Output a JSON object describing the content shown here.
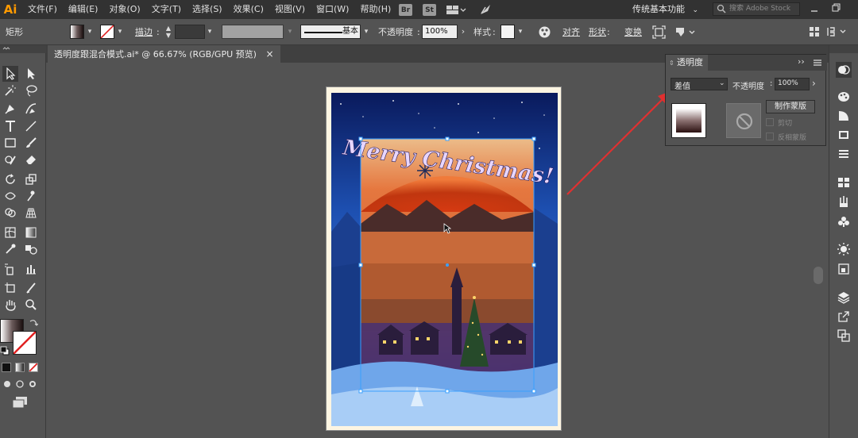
{
  "app": {
    "logo": "Ai",
    "menus": [
      "文件(F)",
      "编辑(E)",
      "对象(O)",
      "文字(T)",
      "选择(S)",
      "效果(C)",
      "视图(V)",
      "窗口(W)",
      "帮助(H)"
    ],
    "badges": [
      "Br",
      "St"
    ],
    "workspace": "传统基本功能",
    "stock_search_placeholder": "搜索 Adobe Stock"
  },
  "control_bar": {
    "selection_type": "矩形",
    "stroke_label": "描边",
    "brush_label": "基本",
    "opacity_label": "不透明度",
    "opacity_value": "100%",
    "style_label": "样式",
    "align_label": "对齐",
    "shape_label": "形状",
    "transform_label": "变换"
  },
  "document_tab": {
    "title": "透明度跟混合模式.ai* @ 66.67% (RGB/GPU 预览)",
    "close": "×"
  },
  "artwork": {
    "headline": "Merry Christmas!"
  },
  "transparency_panel": {
    "title": "透明度",
    "blend_mode": "差值",
    "opacity_label": "不透明度",
    "opacity_value": "100%",
    "make_mask_button": "制作蒙版",
    "clip_label": "剪切",
    "invert_mask_label": "反相蒙版"
  },
  "colors": {
    "accent_orange": "#ff9a00",
    "panel_bg": "#535353",
    "menubar_bg": "#323232",
    "arrow_red": "#e03030"
  }
}
